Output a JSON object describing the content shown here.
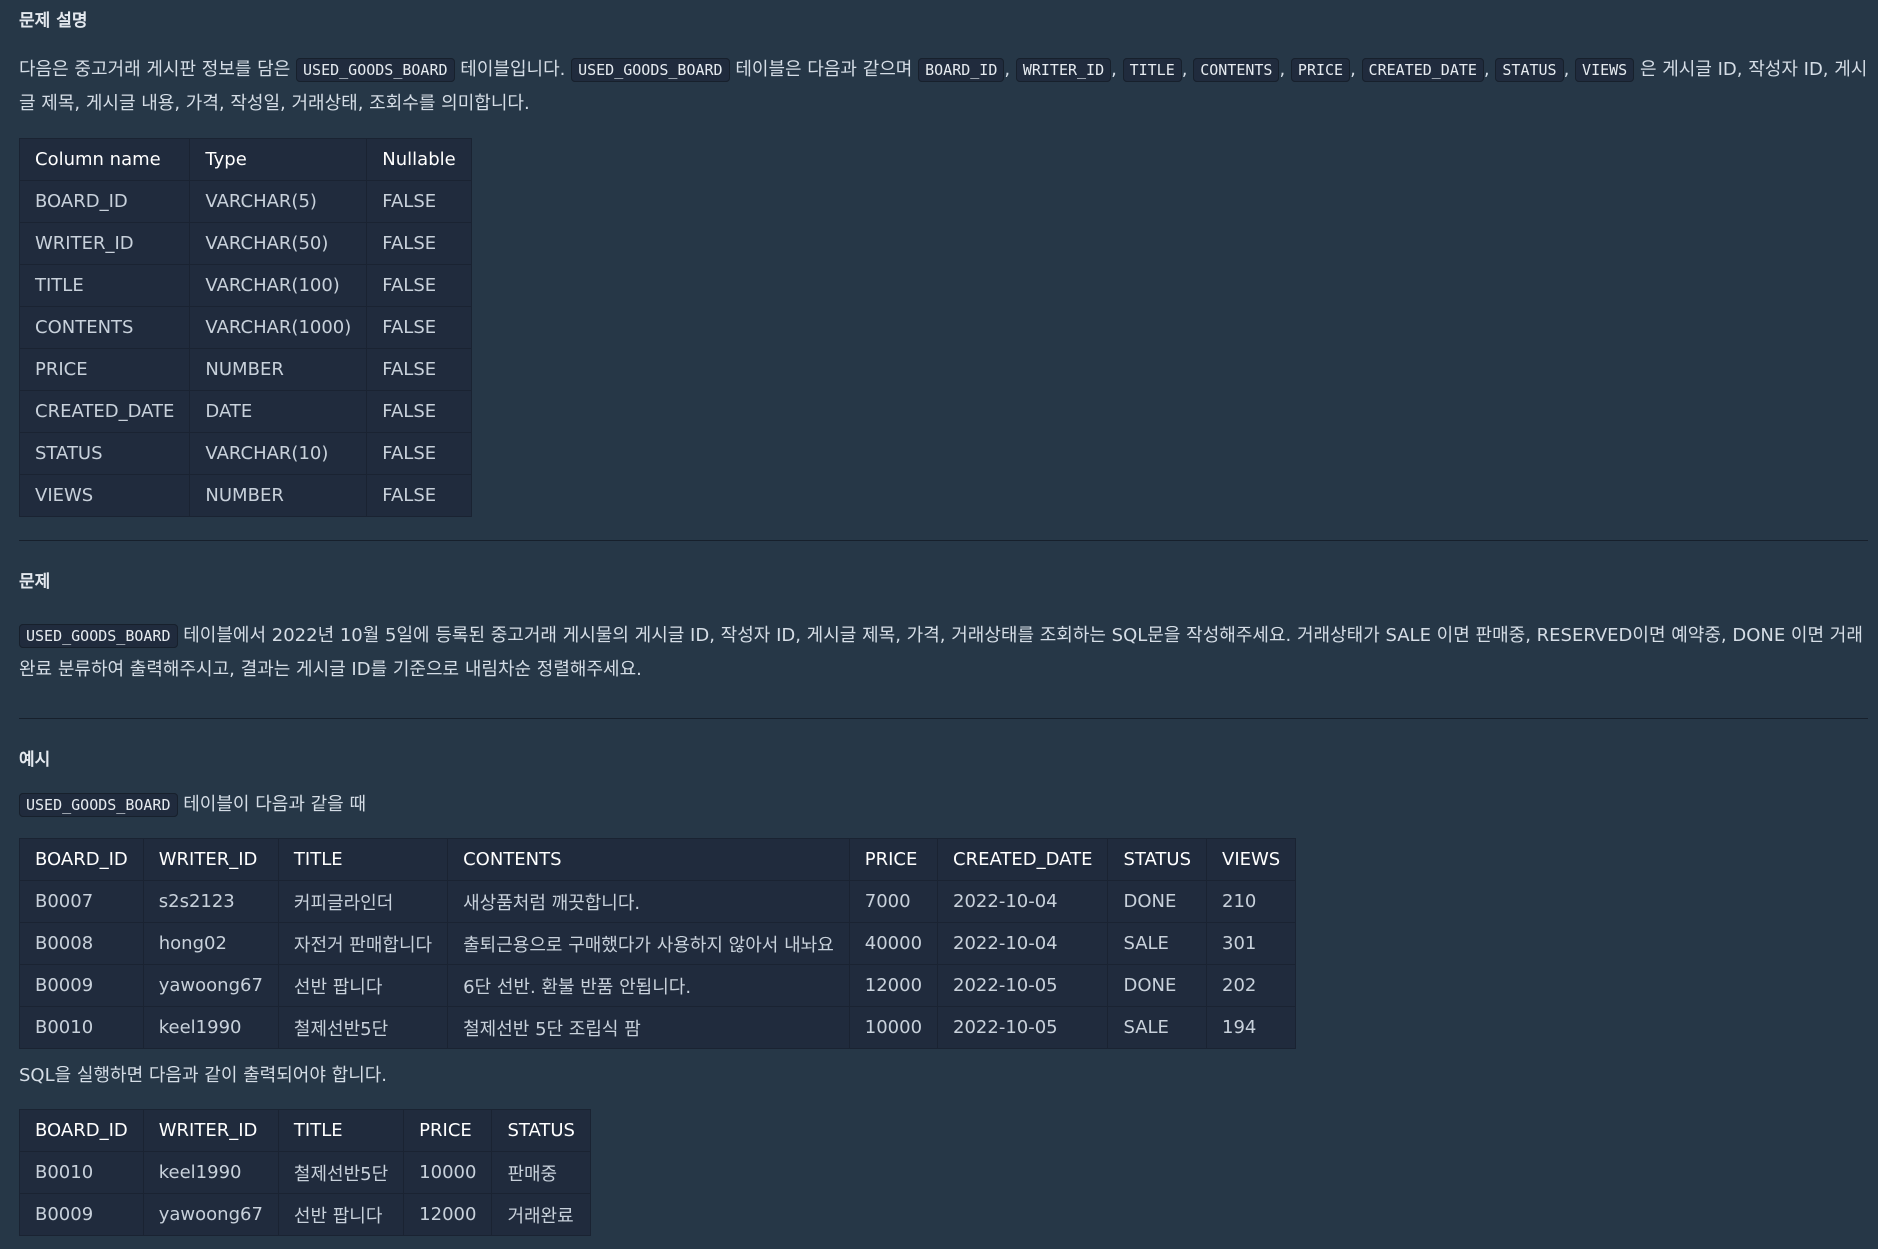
{
  "section1": {
    "title": "문제 설명",
    "text_1": "다음은 중고거래 게시판 정보를 담은",
    "code_1": "USED_GOODS_BOARD",
    "text_2": "테이블입니다.",
    "code_2": "USED_GOODS_BOARD",
    "text_3": "테이블은 다음과 같으며",
    "columns_code": [
      "BOARD_ID",
      "WRITER_ID",
      "TITLE",
      "CONTENTS",
      "PRICE",
      "CREATED_DATE",
      "STATUS",
      "VIEWS"
    ],
    "separator": ",",
    "text_4": "은 게시글 ID, 작성자 ID, 게시글 제목, 게시글 내용, 가격, 작성일, 거래상태, 조회수를 의미합니다."
  },
  "schema_table": {
    "headers": [
      "Column name",
      "Type",
      "Nullable"
    ],
    "rows": [
      [
        "BOARD_ID",
        "VARCHAR(5)",
        "FALSE"
      ],
      [
        "WRITER_ID",
        "VARCHAR(50)",
        "FALSE"
      ],
      [
        "TITLE",
        "VARCHAR(100)",
        "FALSE"
      ],
      [
        "CONTENTS",
        "VARCHAR(1000)",
        "FALSE"
      ],
      [
        "PRICE",
        "NUMBER",
        "FALSE"
      ],
      [
        "CREATED_DATE",
        "DATE",
        "FALSE"
      ],
      [
        "STATUS",
        "VARCHAR(10)",
        "FALSE"
      ],
      [
        "VIEWS",
        "NUMBER",
        "FALSE"
      ]
    ]
  },
  "section2": {
    "title": "문제",
    "code": "USED_GOODS_BOARD",
    "text": "테이블에서 2022년 10월 5일에 등록된 중고거래 게시물의 게시글 ID, 작성자 ID, 게시글 제목, 가격, 거래상태를 조회하는 SQL문을 작성해주세요. 거래상태가 SALE 이면 판매중, RESERVED이면 예약중, DONE 이면 거래완료 분류하여 출력해주시고, 결과는 게시글 ID를 기준으로 내림차순 정렬해주세요."
  },
  "section3": {
    "title": "예시",
    "code": "USED_GOODS_BOARD",
    "intro_text": "테이블이 다음과 같을 때",
    "result_intro": "SQL을 실행하면 다음과 같이 출력되어야 합니다."
  },
  "example_table": {
    "headers": [
      "BOARD_ID",
      "WRITER_ID",
      "TITLE",
      "CONTENTS",
      "PRICE",
      "CREATED_DATE",
      "STATUS",
      "VIEWS"
    ],
    "rows": [
      [
        "B0007",
        "s2s2123",
        "커피글라인더",
        "새상품처럼 깨끗합니다.",
        "7000",
        "2022-10-04",
        "DONE",
        "210"
      ],
      [
        "B0008",
        "hong02",
        "자전거 판매합니다",
        "출퇴근용으로 구매했다가 사용하지 않아서 내놔요",
        "40000",
        "2022-10-04",
        "SALE",
        "301"
      ],
      [
        "B0009",
        "yawoong67",
        "선반 팝니다",
        "6단 선반. 환불 반품 안됩니다.",
        "12000",
        "2022-10-05",
        "DONE",
        "202"
      ],
      [
        "B0010",
        "keel1990",
        "철제선반5단",
        "철제선반 5단 조립식 팜",
        "10000",
        "2022-10-05",
        "SALE",
        "194"
      ]
    ]
  },
  "result_table": {
    "headers": [
      "BOARD_ID",
      "WRITER_ID",
      "TITLE",
      "PRICE",
      "STATUS"
    ],
    "rows": [
      [
        "B0010",
        "keel1990",
        "철제선반5단",
        "10000",
        "판매중"
      ],
      [
        "B0009",
        "yawoong67",
        "선반 팝니다",
        "12000",
        "거래완료"
      ]
    ]
  }
}
